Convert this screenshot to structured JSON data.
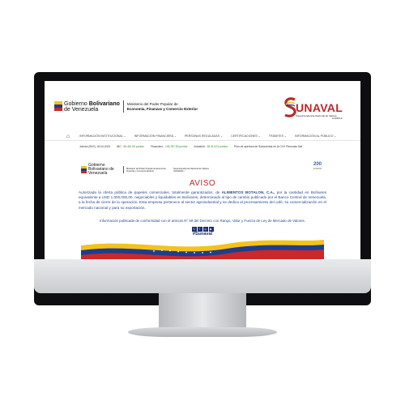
{
  "header": {
    "gov_line1": "Gobierno ",
    "gov_line1_bold": "Bolivariano",
    "gov_line2": "de Venezuela",
    "ministry_line1": "Ministerio del Poder Popular de",
    "ministry_line2": "Economía, Finanzas y Comercio Exterior",
    "brand": "UNAVAL",
    "brand_subtitle": "Superintendencia Nacional de Valores",
    "brand_rif": "G-20001-8"
  },
  "nav": {
    "items": [
      {
        "label": "INFORMACIÓN INSTITUCIONAL ⌄"
      },
      {
        "label": "INFORMACIÓN FINANCIERA ⌄"
      },
      {
        "label": "PERSONAS REGULADAS ⌄"
      },
      {
        "label": "CERTIFICACIONES ⌄"
      },
      {
        "label": "TRÁMITES ⌄"
      },
      {
        "label": "INFORMACIÓN AL PÚBLICO ⌄"
      }
    ]
  },
  "ticker": {
    "date": "Jueves (BVC) 18-04-2024",
    "items": [
      {
        "label": "IBC : ",
        "value": "98.461,53 puntos"
      },
      {
        "label": "Financiero : ",
        "value": "106.787,53 puntos"
      },
      {
        "label": "Industrial : ",
        "value": "28.313,04 puntos"
      }
    ],
    "note": "Pers de apertura de Subcuentas en la CVV Personas Nat"
  },
  "aviso": {
    "logo_gov": "Gobierno Bolivariano de Venezuela",
    "logo_ministry": "Ministerio del Poder Popular de Economía, Finanzas y Comercio Exterior",
    "logo_sunaval": "Superintendencia Nacional de Valores (SUNAVAL)",
    "anniv_number": "200",
    "anniv_text": "SUNAVAL",
    "title": "AVISO",
    "body_pre": "Autorizada la oferta pública de papeles comerciales, totalmente garantizados, de ",
    "body_company": "ALIMENTOS BOTALON, C.A.,",
    "body_post": " por la cantidad en Bolívares equivalente a USD 1.000.000,00, negociables y liquidables en Bolívares, determinado al tipo de cambio publicado por el Banco Central de Venezuela, a la fecha de cierre de la operación. Esta empresa pertenece al sector agroindustrial y se dedica al procesamiento del café, su comercialización en el mercado nacional y para su exportación.",
    "footer": "Información publicada de conformidad con el artículo N° 59 del Decreto con Rango, Valor y Fuerza de Ley de Mercado de Valores.",
    "hashtag": "#Sunaval"
  },
  "colors": {
    "brand_red": "#b8292f",
    "navy": "#1d2f6e",
    "text_blue": "#2a4a8a",
    "green": "#2f8a2f"
  }
}
